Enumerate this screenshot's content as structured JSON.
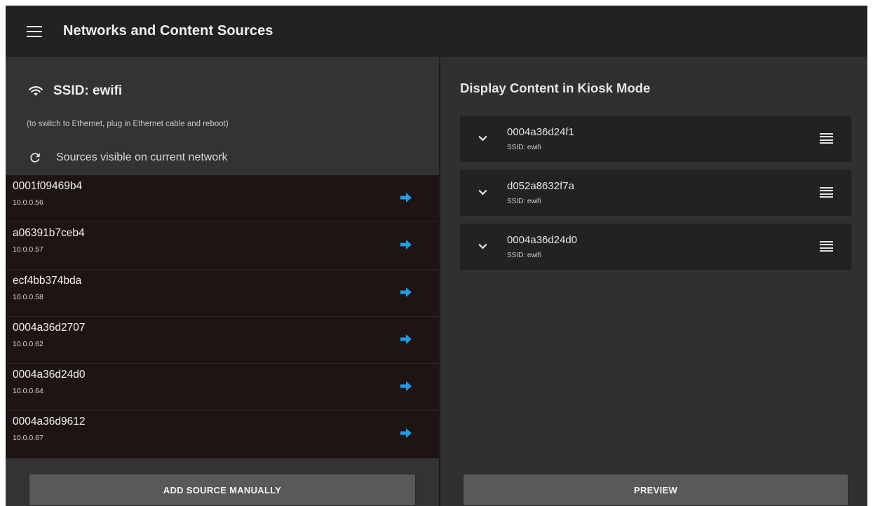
{
  "appbar": {
    "title": "Networks and Content Sources"
  },
  "network": {
    "ssid_label": "SSID: ewifi",
    "hint": "(to switch to Ethernet, plug in Ethernet cable and reboot)",
    "sources_label": "Sources visible on current network"
  },
  "sources": [
    {
      "name": "0001f09469b4",
      "ip": "10.0.0.56"
    },
    {
      "name": "a06391b7ceb4",
      "ip": "10.0.0.57"
    },
    {
      "name": "ecf4bb374bda",
      "ip": "10.0.0.58"
    },
    {
      "name": "0004a36d2707",
      "ip": "10.0.0.62"
    },
    {
      "name": "0004a36d24d0",
      "ip": "10.0.0.64"
    },
    {
      "name": "0004a36d9612",
      "ip": "10.0.0.67"
    }
  ],
  "add_button_label": "ADD SOURCE MANUALLY",
  "kiosk": {
    "title": "Display Content in Kiosk Mode",
    "items": [
      {
        "name": "0004a36d24f1",
        "ssid": "SSID: ewifi"
      },
      {
        "name": "d052a8632f7a",
        "ssid": "SSID: ewifi"
      },
      {
        "name": "0004a36d24d0",
        "ssid": "SSID: ewifi"
      }
    ]
  },
  "preview_button_label": "PREVIEW",
  "icons": {
    "menu": "menu-icon",
    "wifi": "wifi-icon",
    "refresh": "refresh-icon",
    "source_arrow": "arrow-right-icon",
    "expand": "chevron-down-icon",
    "drag": "drag-handle-icon"
  },
  "colors": {
    "accent_arrow": "#1e9be9",
    "appbar": "#222222",
    "panel": "#333333",
    "source_list_bg": "#1e1414",
    "button": "#595959"
  }
}
